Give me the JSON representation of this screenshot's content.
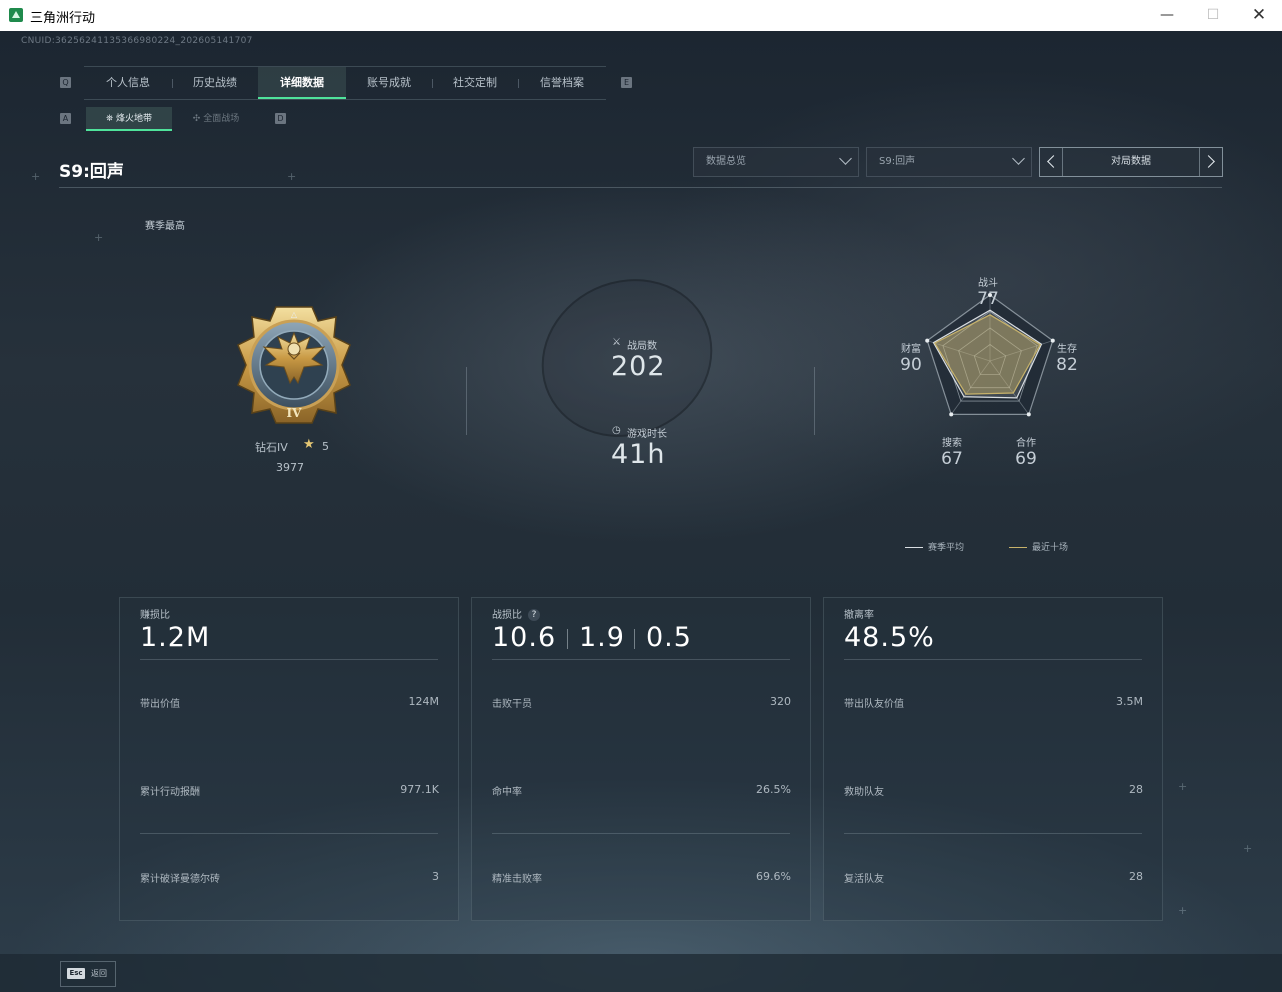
{
  "window": {
    "title": "三角洲行动",
    "minimize_glyph": "—",
    "maximize_glyph": "☐",
    "close_glyph": "✕"
  },
  "uid": "CNUID:36256241135366980224_202605141707",
  "tabs": [
    {
      "label": "个人信息",
      "active": false
    },
    {
      "label": "历史战绩",
      "active": false
    },
    {
      "label": "详细数据",
      "active": true
    },
    {
      "label": "账号成就",
      "active": false
    },
    {
      "label": "社交定制",
      "active": false
    },
    {
      "label": "信誉档案",
      "active": false
    }
  ],
  "tab_keys": {
    "prev": "Q",
    "next": "E"
  },
  "subtabs": [
    {
      "label": "烽火地带",
      "active": true
    },
    {
      "label": "全面战场",
      "active": false
    }
  ],
  "subtab_keys": {
    "prev": "A",
    "next": "D"
  },
  "season": {
    "title": "S9:回声"
  },
  "filters": {
    "view": "数据总览",
    "season": "S9:回声",
    "pager_label": "对局数据"
  },
  "rank": {
    "section_label": "赛季最高",
    "name": "钻石IV",
    "stars": "5",
    "score": "3977",
    "badge_numeral": "IV"
  },
  "summary": {
    "matches_label": "战局数",
    "matches_value": "202",
    "playtime_label": "游戏时长",
    "playtime_value": "41h"
  },
  "radar": {
    "axes": [
      {
        "label": "战斗",
        "value": "77"
      },
      {
        "label": "生存",
        "value": "82"
      },
      {
        "label": "合作",
        "value": "69"
      },
      {
        "label": "搜索",
        "value": "67"
      },
      {
        "label": "财富",
        "value": "90"
      }
    ],
    "season_avg": [
      77,
      82,
      69,
      67,
      90
    ],
    "recent_ten": [
      70,
      80,
      60,
      62,
      88
    ],
    "legend_season_avg": "赛季平均",
    "legend_recent": "最近十场",
    "colors": {
      "season_avg": "#d9dee2",
      "recent": "#c7b26a"
    }
  },
  "panels": [
    {
      "head": "赚损比",
      "big": "1.2M",
      "rows": [
        {
          "label": "带出价值",
          "value": "124M"
        },
        {
          "label": "累计行动报酬",
          "value": "977.1K"
        },
        {
          "label": "累计破译曼德尔砖",
          "value": "3"
        }
      ]
    },
    {
      "head": "战损比",
      "big_parts": [
        "10.6",
        "1.9",
        "0.5"
      ],
      "help": "?",
      "rows": [
        {
          "label": "击败干员",
          "value": "320"
        },
        {
          "label": "命中率",
          "value": "26.5%"
        },
        {
          "label": "精准击败率",
          "value": "69.6%"
        }
      ]
    },
    {
      "head": "撤离率",
      "big": "48.5%",
      "rows": [
        {
          "label": "带出队友价值",
          "value": "3.5M"
        },
        {
          "label": "救助队友",
          "value": "28"
        },
        {
          "label": "复活队友",
          "value": "28"
        }
      ]
    }
  ],
  "footer": {
    "esc_key": "Esc",
    "esc_label": "返回"
  },
  "accent": "#4fe39b"
}
